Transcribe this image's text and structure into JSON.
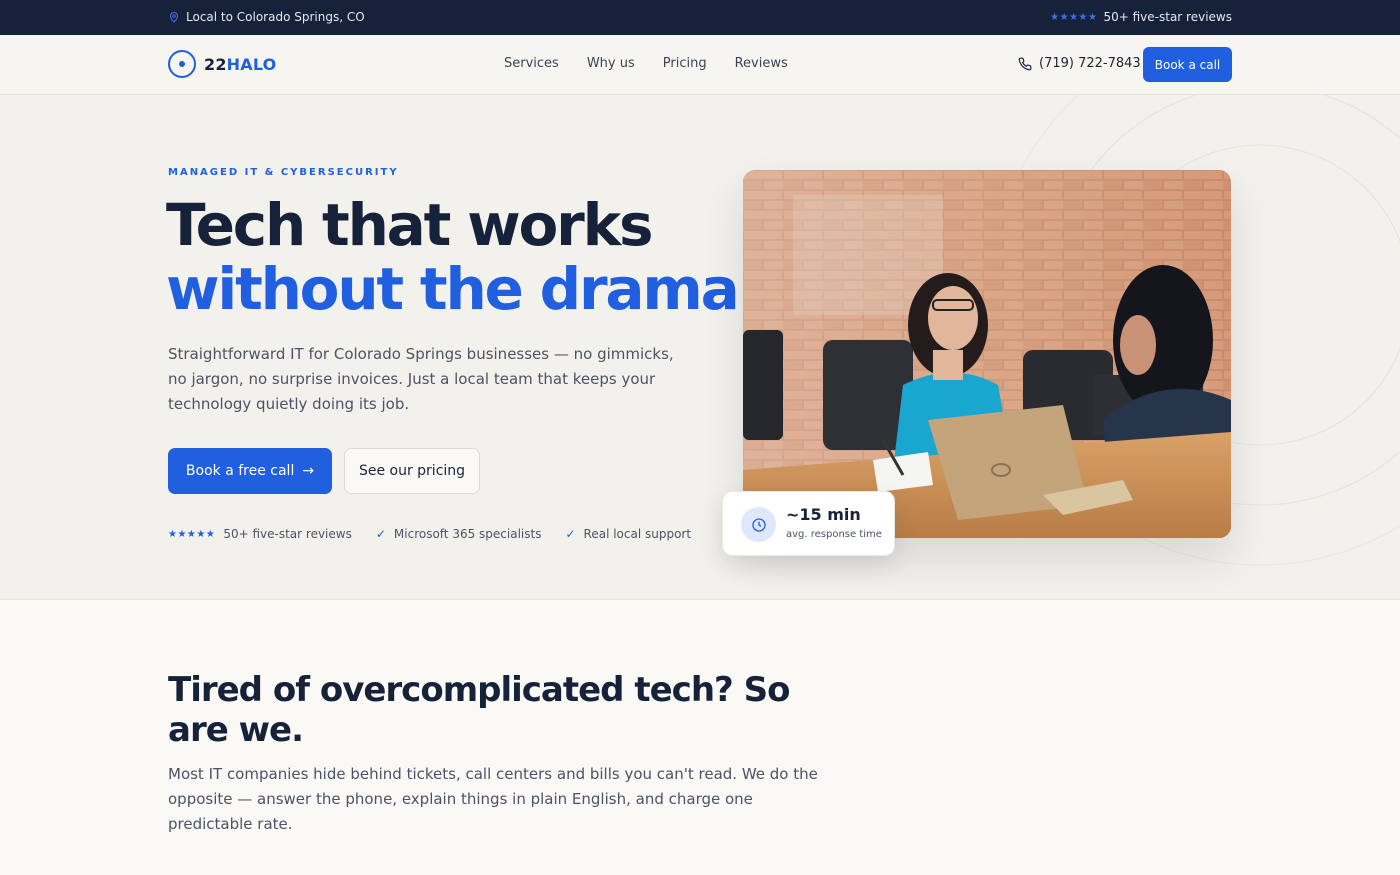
{
  "topbar": {
    "location": "Local to Colorado Springs, CO",
    "reviews_stars": "★★★★★",
    "reviews_text": "50+ five-star reviews"
  },
  "nav": {
    "logo_number": "22",
    "logo_word": "HALO",
    "links": [
      "Services",
      "Why us",
      "Pricing",
      "Reviews"
    ],
    "phone": "(719) 722-7843",
    "book_label": "Book a call"
  },
  "hero": {
    "eyebrow": "MANAGED IT & CYBERSECURITY",
    "headline_line1": "Tech that works",
    "headline_line2": "without the drama.",
    "lead": "Straightforward IT for Colorado Springs businesses — no gimmicks, no jargon, no surprise invoices. Just a local team that keeps your technology quietly doing its job.",
    "cta_primary": "Book a free call",
    "cta_primary_arrow": "→",
    "cta_secondary": "See our pricing",
    "trust": {
      "stars": "★★★★★",
      "reviews": "50+ five-star reviews",
      "check_glyph": "✓",
      "item2": "Microsoft 365 specialists",
      "item3": "Real local support"
    },
    "badge": {
      "value": "~15 min",
      "label": "avg. response time"
    }
  },
  "section2": {
    "heading": "Tired of overcomplicated tech? So are we.",
    "body": "Most IT companies hide behind tickets, call centers and bills you can't read. We do the opposite — answer the phone, explain things in plain English, and charge one predictable rate."
  },
  "colors": {
    "brand_blue": "#1f5fe0",
    "navy": "#16223a",
    "background": "#f3f1ec"
  }
}
